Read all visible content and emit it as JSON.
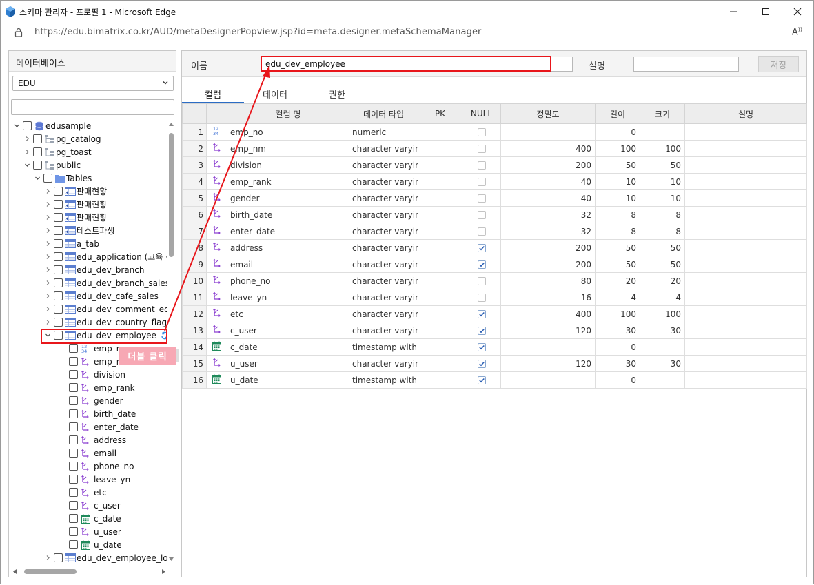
{
  "window": {
    "title": "스키마 관리자 - 프로필 1 - Microsoft Edge",
    "url": "https://edu.bimatrix.co.kr/AUD/metaDesignerPopview.jsp?id=meta.designer.metaSchemaManager"
  },
  "left": {
    "header": "데이터베이스",
    "db_selected": "EDU",
    "search_value": "",
    "tooltip": "더블 클릭",
    "tree": [
      {
        "label": "edusample",
        "icon": "database-icon",
        "level": 0,
        "twisty": "open"
      },
      {
        "label": "pg_catalog",
        "icon": "schema-icon",
        "level": 1,
        "twisty": "closed"
      },
      {
        "label": "pg_toast",
        "icon": "schema-icon",
        "level": 1,
        "twisty": "closed"
      },
      {
        "label": "public",
        "icon": "schema-icon",
        "level": 1,
        "twisty": "open"
      },
      {
        "label": "Tables",
        "icon": "folder-icon",
        "level": 2,
        "twisty": "open"
      },
      {
        "label": "판매현황",
        "icon": "table-plus-icon",
        "level": 3,
        "twisty": "closed"
      },
      {
        "label": "판매현황",
        "icon": "table-plus-icon",
        "level": 3,
        "twisty": "closed"
      },
      {
        "label": "판매현황",
        "icon": "table-plus-icon",
        "level": 3,
        "twisty": "closed"
      },
      {
        "label": "테스트파생",
        "icon": "table-plus-icon",
        "level": 3,
        "twisty": "closed"
      },
      {
        "label": "a_tab",
        "icon": "table-icon",
        "level": 3,
        "twisty": "closed"
      },
      {
        "label": "edu_application (교육 신",
        "icon": "table-icon",
        "level": 3,
        "twisty": "closed"
      },
      {
        "label": "edu_dev_branch",
        "icon": "table-icon",
        "level": 3,
        "twisty": "closed"
      },
      {
        "label": "edu_dev_branch_sales",
        "icon": "table-icon",
        "level": 3,
        "twisty": "closed"
      },
      {
        "label": "edu_dev_cafe_sales",
        "icon": "table-icon",
        "level": 3,
        "twisty": "closed"
      },
      {
        "label": "edu_dev_comment_edit",
        "icon": "table-icon",
        "level": 3,
        "twisty": "closed"
      },
      {
        "label": "edu_dev_country_flag",
        "icon": "table-icon",
        "level": 3,
        "twisty": "closed"
      },
      {
        "label": "edu_dev_employee",
        "icon": "table-icon",
        "level": 3,
        "twisty": "open",
        "refresh": true
      },
      {
        "label": "emp_no",
        "icon": "numeric-icon",
        "level": 4,
        "twisty": "none"
      },
      {
        "label": "emp_nm",
        "icon": "string-icon",
        "level": 4,
        "twisty": "none"
      },
      {
        "label": "division",
        "icon": "string-icon",
        "level": 4,
        "twisty": "none"
      },
      {
        "label": "emp_rank",
        "icon": "string-icon",
        "level": 4,
        "twisty": "none"
      },
      {
        "label": "gender",
        "icon": "string-icon",
        "level": 4,
        "twisty": "none"
      },
      {
        "label": "birth_date",
        "icon": "string-icon",
        "level": 4,
        "twisty": "none"
      },
      {
        "label": "enter_date",
        "icon": "string-icon",
        "level": 4,
        "twisty": "none"
      },
      {
        "label": "address",
        "icon": "string-icon",
        "level": 4,
        "twisty": "none"
      },
      {
        "label": "email",
        "icon": "string-icon",
        "level": 4,
        "twisty": "none"
      },
      {
        "label": "phone_no",
        "icon": "string-icon",
        "level": 4,
        "twisty": "none"
      },
      {
        "label": "leave_yn",
        "icon": "string-icon",
        "level": 4,
        "twisty": "none"
      },
      {
        "label": "etc",
        "icon": "string-icon",
        "level": 4,
        "twisty": "none"
      },
      {
        "label": "c_user",
        "icon": "string-icon",
        "level": 4,
        "twisty": "none"
      },
      {
        "label": "c_date",
        "icon": "calendar-icon",
        "level": 4,
        "twisty": "none"
      },
      {
        "label": "u_user",
        "icon": "string-icon",
        "level": 4,
        "twisty": "none"
      },
      {
        "label": "u_date",
        "icon": "calendar-icon",
        "level": 4,
        "twisty": "none"
      },
      {
        "label": "edu_dev_employee_log",
        "icon": "table-icon",
        "level": 3,
        "twisty": "closed"
      }
    ]
  },
  "right": {
    "name_label": "이름",
    "name_value": "edu_dev_employee",
    "desc_label": "설명",
    "desc_value": "",
    "save_label": "저장",
    "tabs": [
      "컬럼",
      "데이터",
      "권한"
    ],
    "active_tab": 0,
    "columns": [
      "",
      "",
      "컬럼 명",
      "데이터 타입",
      "PK",
      "NULL",
      "정밀도",
      "길이",
      "크기",
      "설명"
    ],
    "rows": [
      {
        "n": "1",
        "icon": "numeric-icon",
        "name": "emp_no",
        "type": "numeric",
        "pk": "",
        "null": false,
        "precision": "",
        "length": "0",
        "size": "",
        "desc": ""
      },
      {
        "n": "2",
        "icon": "string-icon",
        "name": "emp_nm",
        "type": "character varying",
        "pk": "",
        "null": false,
        "precision": "400",
        "length": "100",
        "size": "100",
        "desc": ""
      },
      {
        "n": "3",
        "icon": "string-icon",
        "name": "division",
        "type": "character varying",
        "pk": "",
        "null": false,
        "precision": "200",
        "length": "50",
        "size": "50",
        "desc": ""
      },
      {
        "n": "4",
        "icon": "string-icon",
        "name": "emp_rank",
        "type": "character varying",
        "pk": "",
        "null": false,
        "precision": "40",
        "length": "10",
        "size": "10",
        "desc": ""
      },
      {
        "n": "5",
        "icon": "string-icon",
        "name": "gender",
        "type": "character varying",
        "pk": "",
        "null": false,
        "precision": "40",
        "length": "10",
        "size": "10",
        "desc": ""
      },
      {
        "n": "6",
        "icon": "string-icon",
        "name": "birth_date",
        "type": "character varying",
        "pk": "",
        "null": false,
        "precision": "32",
        "length": "8",
        "size": "8",
        "desc": ""
      },
      {
        "n": "7",
        "icon": "string-icon",
        "name": "enter_date",
        "type": "character varying",
        "pk": "",
        "null": false,
        "precision": "32",
        "length": "8",
        "size": "8",
        "desc": ""
      },
      {
        "n": "8",
        "icon": "string-icon",
        "name": "address",
        "type": "character varying",
        "pk": "",
        "null": true,
        "precision": "200",
        "length": "50",
        "size": "50",
        "desc": ""
      },
      {
        "n": "9",
        "icon": "string-icon",
        "name": "email",
        "type": "character varying",
        "pk": "",
        "null": true,
        "precision": "200",
        "length": "50",
        "size": "50",
        "desc": ""
      },
      {
        "n": "10",
        "icon": "string-icon",
        "name": "phone_no",
        "type": "character varying",
        "pk": "",
        "null": false,
        "precision": "80",
        "length": "20",
        "size": "20",
        "desc": ""
      },
      {
        "n": "11",
        "icon": "string-icon",
        "name": "leave_yn",
        "type": "character varying",
        "pk": "",
        "null": false,
        "precision": "16",
        "length": "4",
        "size": "4",
        "desc": ""
      },
      {
        "n": "12",
        "icon": "string-icon",
        "name": "etc",
        "type": "character varying",
        "pk": "",
        "null": true,
        "precision": "400",
        "length": "100",
        "size": "100",
        "desc": ""
      },
      {
        "n": "13",
        "icon": "string-icon",
        "name": "c_user",
        "type": "character varying",
        "pk": "",
        "null": true,
        "precision": "120",
        "length": "30",
        "size": "30",
        "desc": ""
      },
      {
        "n": "14",
        "icon": "calendar-icon",
        "name": "c_date",
        "type": "timestamp with...",
        "pk": "",
        "null": true,
        "precision": "",
        "length": "0",
        "size": "",
        "desc": ""
      },
      {
        "n": "15",
        "icon": "string-icon",
        "name": "u_user",
        "type": "character varying",
        "pk": "",
        "null": true,
        "precision": "120",
        "length": "30",
        "size": "30",
        "desc": ""
      },
      {
        "n": "16",
        "icon": "calendar-icon",
        "name": "u_date",
        "type": "timestamp with...",
        "pk": "",
        "null": true,
        "precision": "",
        "length": "0",
        "size": "",
        "desc": ""
      }
    ]
  },
  "colors": {
    "highlight": "#e8161b",
    "accent": "#2b6cc4",
    "tooltip": "#f7a8b4"
  }
}
